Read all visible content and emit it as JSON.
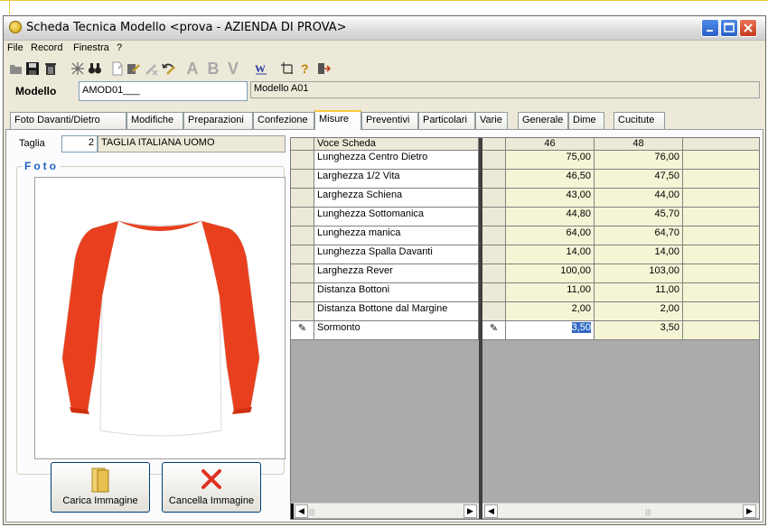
{
  "window": {
    "title": "Scheda Tecnica Modello <prova - AZIENDA DI PROVA>"
  },
  "menu": [
    "File",
    "Record",
    "Finestra",
    "?"
  ],
  "toolbar": {
    "icons": [
      "open-icon",
      "save-icon",
      "delete-icon",
      "cut-icon",
      "binoculars-icon",
      "new-icon",
      "edit-icon",
      "cancel-edit-icon",
      "undo-icon",
      "w-icon",
      "grid-icon",
      "help-icon",
      "exit-icon"
    ],
    "letters": [
      "A",
      "B",
      "V"
    ]
  },
  "modello": {
    "label": "Modello",
    "code": "AMOD01___",
    "description": "Modello A01"
  },
  "tabs": [
    "Foto Davanti/Dietro",
    "Modifiche",
    "Preparazioni",
    "Confezione",
    "Misure",
    "Preventivi",
    "Particolari",
    "Varie",
    "Generale",
    "Dime",
    "Cucitute"
  ],
  "active_tab": "Misure",
  "taglia": {
    "label": "Taglia",
    "number": "2",
    "description": "TAGLIA ITALIANA UOMO"
  },
  "foto": {
    "legend": "Foto",
    "load_button": "Carica Immagine",
    "delete_button": "Cancella Immagine"
  },
  "grid": {
    "header_left": "Voce Scheda",
    "size_columns": [
      "46",
      "48"
    ],
    "rows": [
      {
        "voce": "Lunghezza Centro Dietro",
        "values": [
          "75,00",
          "76,00"
        ]
      },
      {
        "voce": "Larghezza 1/2 Vita",
        "values": [
          "46,50",
          "47,50"
        ]
      },
      {
        "voce": "Larghezza Schiena",
        "values": [
          "43,00",
          "44,00"
        ]
      },
      {
        "voce": "Lunghezza Sottomanica",
        "values": [
          "44,80",
          "45,70"
        ]
      },
      {
        "voce": "Lunghezza manica",
        "values": [
          "64,00",
          "64,70"
        ]
      },
      {
        "voce": "Lunghezza Spalla Davanti",
        "values": [
          "14,00",
          "14,00"
        ]
      },
      {
        "voce": "Larghezza Rever",
        "values": [
          "100,00",
          "103,00"
        ]
      },
      {
        "voce": "Distanza Bottoni",
        "values": [
          "11,00",
          "11,00"
        ]
      },
      {
        "voce": "Distanza Bottone dal Margine",
        "values": [
          "2,00",
          "2,00"
        ]
      },
      {
        "voce": "Sormonto",
        "values": [
          "3,50",
          "3,50"
        ]
      }
    ],
    "current_row_index": 9
  }
}
